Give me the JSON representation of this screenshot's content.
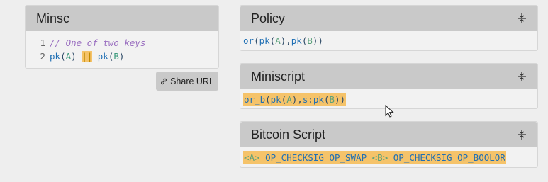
{
  "minsc": {
    "title": "Minsc",
    "lines": [
      {
        "num": "1",
        "comment": "// One of two keys"
      },
      {
        "num": "2",
        "fn1": "pk",
        "arg1": "A",
        "op": "||",
        "fn2": "pk",
        "arg2": "B"
      }
    ]
  },
  "share": {
    "label": "Share URL",
    "icon": "link-icon"
  },
  "policy": {
    "title": "Policy",
    "code": {
      "or": "or",
      "pk1": "pk",
      "a": "A",
      "pk2": "pk",
      "b": "B"
    }
  },
  "miniscript": {
    "title": "Miniscript",
    "code": {
      "or_b": "or_b",
      "pk1": "pk",
      "a": "A",
      "s": "s",
      "pk2": "pk",
      "b": "B"
    }
  },
  "bitcoin": {
    "title": "Bitcoin Script",
    "tokens": [
      "<A>",
      "OP_CHECKSIG",
      "OP_SWAP",
      "<B>",
      "OP_CHECKSIG",
      "OP_BOOLOR"
    ]
  },
  "colors": {
    "highlight": "#f5c36a",
    "header": "#c9c9c9",
    "keyword": "#1f6fb4",
    "comment": "#9a6fc0"
  }
}
